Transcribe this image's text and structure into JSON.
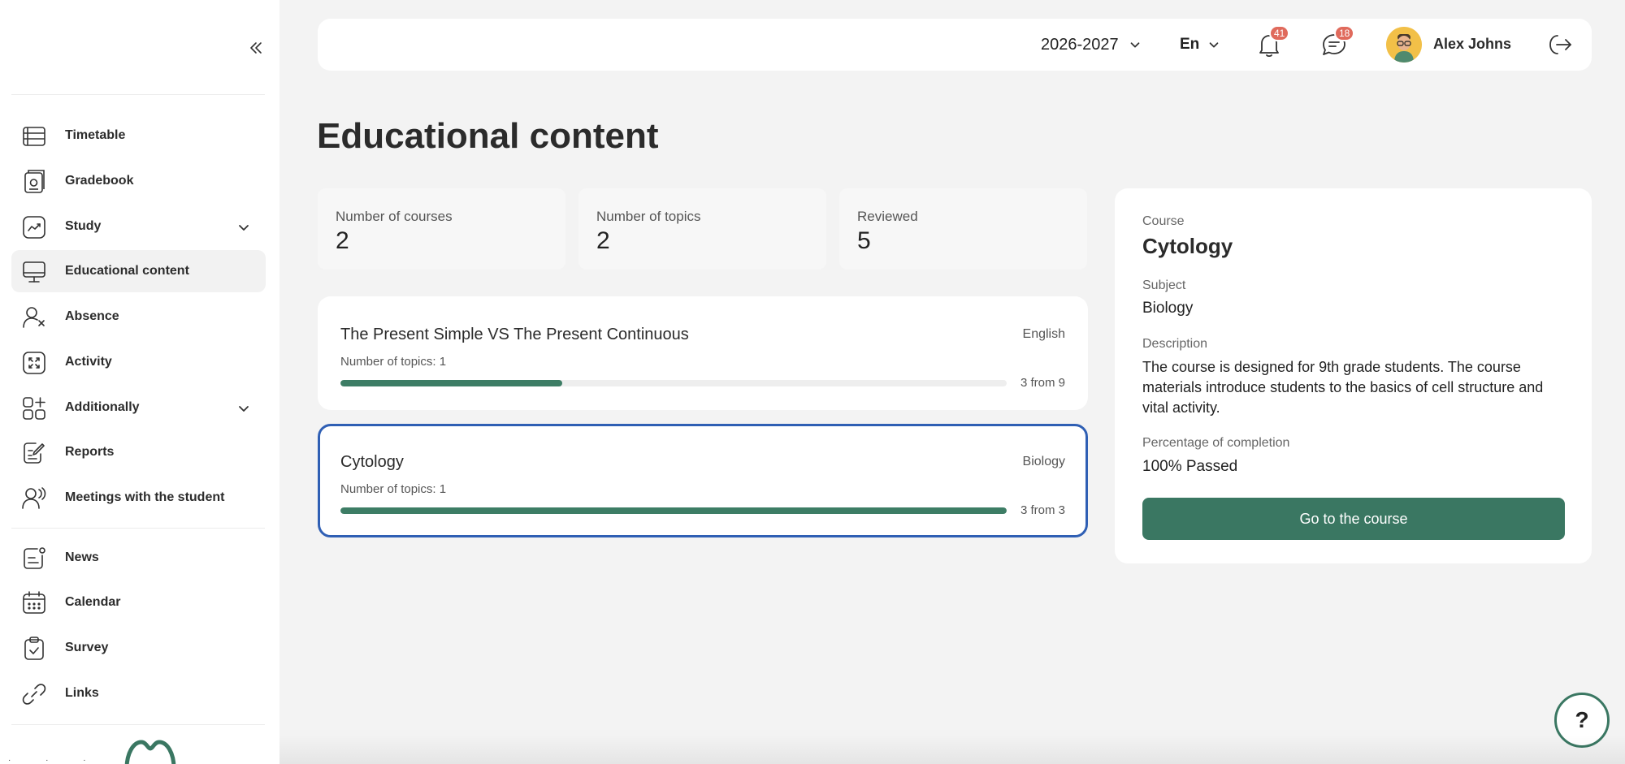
{
  "sidebar": {
    "items": [
      {
        "label": "Timetable",
        "icon": "timetable-icon"
      },
      {
        "label": "Gradebook",
        "icon": "gradebook-icon"
      },
      {
        "label": "Study",
        "icon": "study-icon",
        "expandable": true
      },
      {
        "label": "Educational content",
        "icon": "monitor-icon",
        "active": true
      },
      {
        "label": "Absence",
        "icon": "absence-icon"
      },
      {
        "label": "Activity",
        "icon": "activity-icon"
      },
      {
        "label": "Additionally",
        "icon": "grid-plus-icon",
        "expandable": true
      },
      {
        "label": "Reports",
        "icon": "reports-icon"
      },
      {
        "label": "Meetings with the student",
        "icon": "meetings-icon"
      },
      {
        "label": "News",
        "icon": "news-icon"
      },
      {
        "label": "Calendar",
        "icon": "calendar-icon"
      },
      {
        "label": "Survey",
        "icon": "survey-icon"
      },
      {
        "label": "Links",
        "icon": "link-icon"
      }
    ]
  },
  "header": {
    "year": "2026-2027",
    "language": "En",
    "notifications_count": "41",
    "messages_count": "18",
    "user_name": "Alex Johns"
  },
  "page": {
    "title": "Educational content"
  },
  "stats": [
    {
      "label": "Number of courses",
      "value": "2"
    },
    {
      "label": "Number of topics",
      "value": "2"
    },
    {
      "label": "Reviewed",
      "value": "5"
    }
  ],
  "courses": [
    {
      "title": "The Present Simple VS The Present Continuous",
      "subject": "English",
      "topics": "Number of topics: 1",
      "progress_text": "3 from 9",
      "progress_fraction": 0.333
    },
    {
      "title": "Cytology",
      "subject": "Biology",
      "topics": "Number of topics: 1",
      "progress_text": "3 from 3",
      "progress_fraction": 1.0,
      "selected": true
    }
  ],
  "detail": {
    "course_label": "Course",
    "course": "Cytology",
    "subject_label": "Subject",
    "subject": "Biology",
    "description_label": "Description",
    "description": "The course is designed for 9th grade students. The course materials introduce students to the basics of cell structure and vital activity.",
    "completion_label": "Percentage of completion",
    "completion": "100% Passed",
    "button_label": "Go to the course"
  },
  "help": {
    "label": "?"
  },
  "colors": {
    "accent": "#3a7762",
    "selected_border": "#2f5fb4",
    "badge": "#e06a5c"
  }
}
